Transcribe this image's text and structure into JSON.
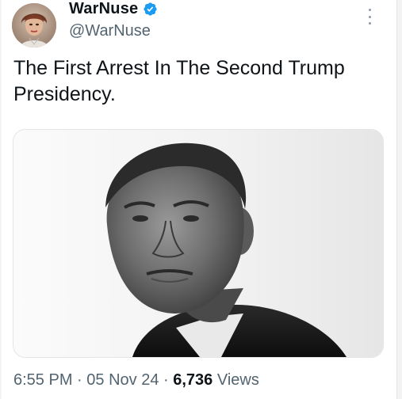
{
  "user": {
    "display_name": "WarNuse",
    "handle": "@WarNuse",
    "verified_color": "#1d9bf0"
  },
  "tweet": {
    "text": "The First Arrest In The Second Trump Presidency.",
    "time": "6:55 PM",
    "separator": " · ",
    "date": "05 Nov 24",
    "views_count": "6,736",
    "views_label": "Views"
  },
  "icons": {
    "verified": "verified-badge-icon",
    "more": "more-options-icon"
  }
}
